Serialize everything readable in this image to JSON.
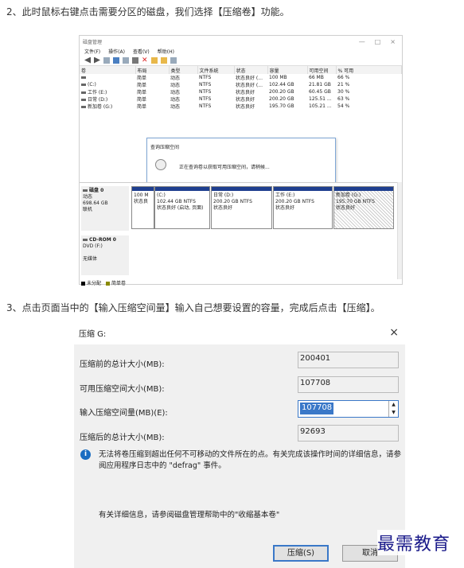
{
  "steps": {
    "step2": "2、此时鼠标右键点击需要分区的磁盘，我们选择【压缩卷】功能。",
    "step3": "3、点击页面当中的【输入压缩空间量】输入自己想要设置的容量，完成后点击【压缩】。"
  },
  "disk_mgmt": {
    "title": "磁盘管理",
    "menu": [
      "文件(F)",
      "操作(A)",
      "查看(V)",
      "帮助(H)"
    ],
    "window_buttons": [
      "—",
      "□",
      "×"
    ],
    "columns": [
      "卷",
      "布局",
      "类型",
      "文件系统",
      "状态",
      "容量",
      "可用空间",
      "% 可用"
    ],
    "rows": [
      [
        "",
        "简单",
        "动态",
        "NTFS",
        "状态良好 (...",
        "100 MB",
        "66 MB",
        "66 %"
      ],
      [
        "(C:)",
        "简单",
        "动态",
        "NTFS",
        "状态良好 (...",
        "102.44 GB",
        "21.81 GB",
        "21 %"
      ],
      [
        "工作 (E:)",
        "简单",
        "动态",
        "NTFS",
        "状态良好",
        "200.20 GB",
        "60.45 GB",
        "30 %"
      ],
      [
        "日常 (D:)",
        "简单",
        "动态",
        "NTFS",
        "状态良好",
        "200.20 GB",
        "125.51 ...",
        "63 %"
      ],
      [
        "新加卷 (G:)",
        "简单",
        "动态",
        "NTFS",
        "状态良好",
        "195.70 GB",
        "105.21 ...",
        "54 %"
      ]
    ],
    "query_dialog": {
      "title": "查询压缩空间",
      "message": "正在查询卷以获取可用压缩空间，请稍候..."
    },
    "disk0": {
      "name": "磁盘 0",
      "type": "动态",
      "size": "698.64 GB",
      "status": "联机",
      "partitions": [
        {
          "l1": "100 M",
          "l2": "状态良",
          "l3": ""
        },
        {
          "l1": "(C:)",
          "l2": "102.44 GB NTFS",
          "l3": "状态良好 (启动, 页面)"
        },
        {
          "l1": "日常 (D:)",
          "l2": "200.20 GB NTFS",
          "l3": "状态良好"
        },
        {
          "l1": "工作 (E:)",
          "l2": "200.20 GB NTFS",
          "l3": "状态良好"
        },
        {
          "l1": "新加卷 (G:)",
          "l2": "195.70 GB NTFS",
          "l3": "状态良好"
        }
      ]
    },
    "cdrom": {
      "name": "CD-ROM 0",
      "drive": "DVD (F:)",
      "status": "无媒体"
    },
    "legend": [
      "未分配",
      "简单卷"
    ],
    "colors": {
      "unallocated": "#000000",
      "simple": "#8a8a00",
      "partition_bar": "#1f3f8f"
    }
  },
  "shrink_dialog": {
    "title": "压缩 G:",
    "close": "×",
    "fields": [
      {
        "label": "压缩前的总计大小(MB):",
        "value": "200401"
      },
      {
        "label": "可用压缩空间大小(MB):",
        "value": "107708"
      },
      {
        "label": "输入压缩空间量(MB)(E):",
        "value": "107708"
      },
      {
        "label": "压缩后的总计大小(MB):",
        "value": "92693"
      }
    ],
    "note": "无法将卷压缩到超出任何不可移动的文件所在的点。有关完成该操作时间的详细信息，请参阅应用程序日志中的 \"defrag\" 事件。",
    "more_info": "有关详细信息，请参阅磁盘管理帮助中的\"收缩基本卷\"",
    "shrink_button": "压缩(S)",
    "cancel_button": "取消"
  },
  "watermark": "最需教育"
}
